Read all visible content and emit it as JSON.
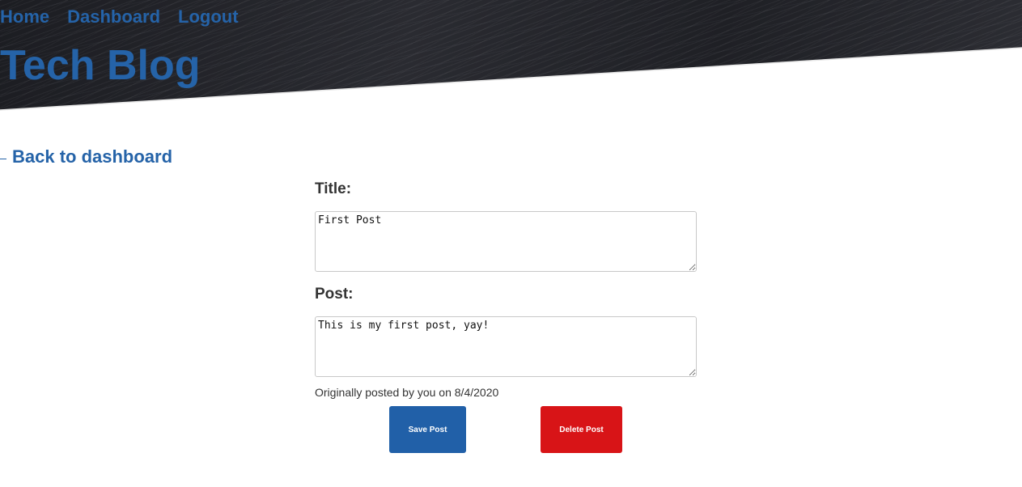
{
  "nav": {
    "items": [
      {
        "label": "Home"
      },
      {
        "label": "Dashboard"
      },
      {
        "label": "Logout"
      }
    ]
  },
  "header": {
    "site_title": "Tech Blog"
  },
  "back_link": {
    "label": "Back to dashboard"
  },
  "form": {
    "title_label": "Title:",
    "title_value": "First Post",
    "post_label": "Post:",
    "post_value": "This is my first post, yay!",
    "meta_text": "Originally posted by you on 8/4/2020",
    "save_label": "Save Post",
    "delete_label": "Delete Post"
  },
  "colors": {
    "brand_blue": "#2563a8",
    "save_button": "#2160a8",
    "delete_button": "#d81417",
    "header_background": "#222328"
  }
}
